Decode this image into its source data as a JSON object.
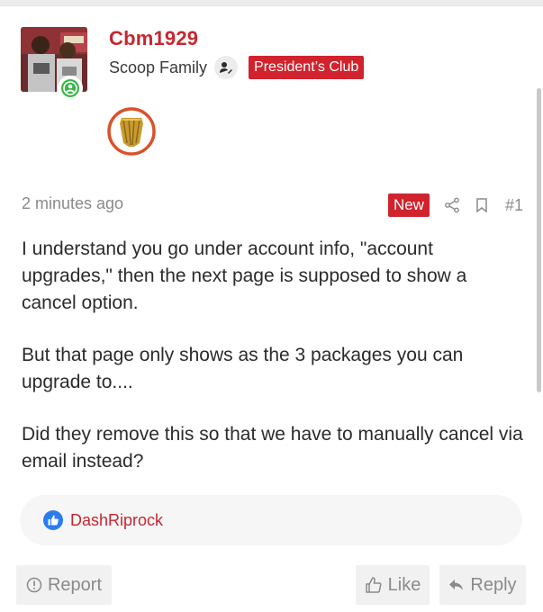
{
  "post": {
    "author": {
      "username": "Cbm1929",
      "member_type": "Scoop Family",
      "club_badge": "President’s Club",
      "online": true,
      "avatar_icon": "avatar-photo",
      "member_icon": "user-pen-icon",
      "trophy_icon": "gold-trophy-icon"
    },
    "time_ago": "2 minutes ago",
    "new_label": "New",
    "post_number": "#1",
    "body": [
      "I understand you go under account info, \"account upgrades,\" then the next page is supposed to show a cancel option.",
      "But that page only shows as the 3 packages you can upgrade to....",
      "Did they remove this so that we have to manually cancel via email instead?"
    ],
    "reactions": {
      "icon": "thumbs-up-icon",
      "users": "DashRiprock"
    },
    "actions": {
      "report": "Report",
      "like": "Like",
      "reply": "Reply"
    }
  },
  "colors": {
    "accent_red": "#c8262f",
    "badge_red": "#d1232d",
    "online_green": "#3bb54a",
    "like_blue": "#2d7cf0",
    "muted_text": "#8a8a8a"
  }
}
